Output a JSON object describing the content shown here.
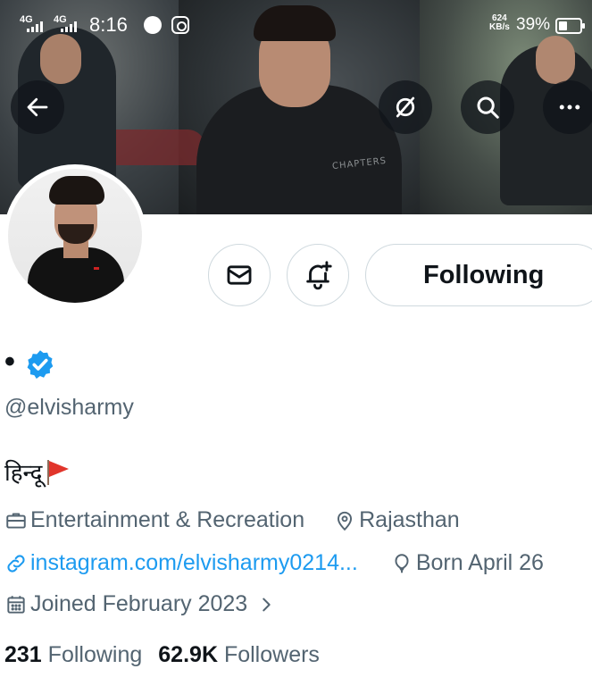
{
  "status_bar": {
    "network1": "4G",
    "network2": "4G",
    "time": "8:16",
    "speed_value": "624",
    "speed_unit": "KB/s",
    "battery": "39%"
  },
  "banner": {
    "chest_text": "CHAPTERS"
  },
  "profile": {
    "display_name": "•",
    "verified": true,
    "handle": "@elvisharmy",
    "bio": "हिन्दू",
    "category": "Entertainment & Recreation",
    "location": "Rajasthan",
    "website": "instagram.com/elvisharmy0214...",
    "birthday": "Born April 26",
    "joined": "Joined February 2023"
  },
  "actions": {
    "following_label": "Following"
  },
  "stats": {
    "following_count": "231",
    "following_label": "Following",
    "followers_count": "62.9K",
    "followers_label": "Followers"
  },
  "icons": {
    "back": "arrow-left-icon",
    "unmention": "slash-circle-icon",
    "search": "search-icon",
    "more": "more-dots-icon",
    "message": "envelope-icon",
    "notify": "bell-plus-icon",
    "verified": "verified-badge-icon",
    "category": "briefcase-icon",
    "location": "location-pin-icon",
    "website": "link-icon",
    "birthday": "balloon-icon",
    "joined": "calendar-icon",
    "flag": "flag-icon"
  },
  "colors": {
    "accent": "#1d9bf0",
    "text_primary": "#0f1419",
    "text_secondary": "#536471",
    "border": "#cfd9de"
  }
}
